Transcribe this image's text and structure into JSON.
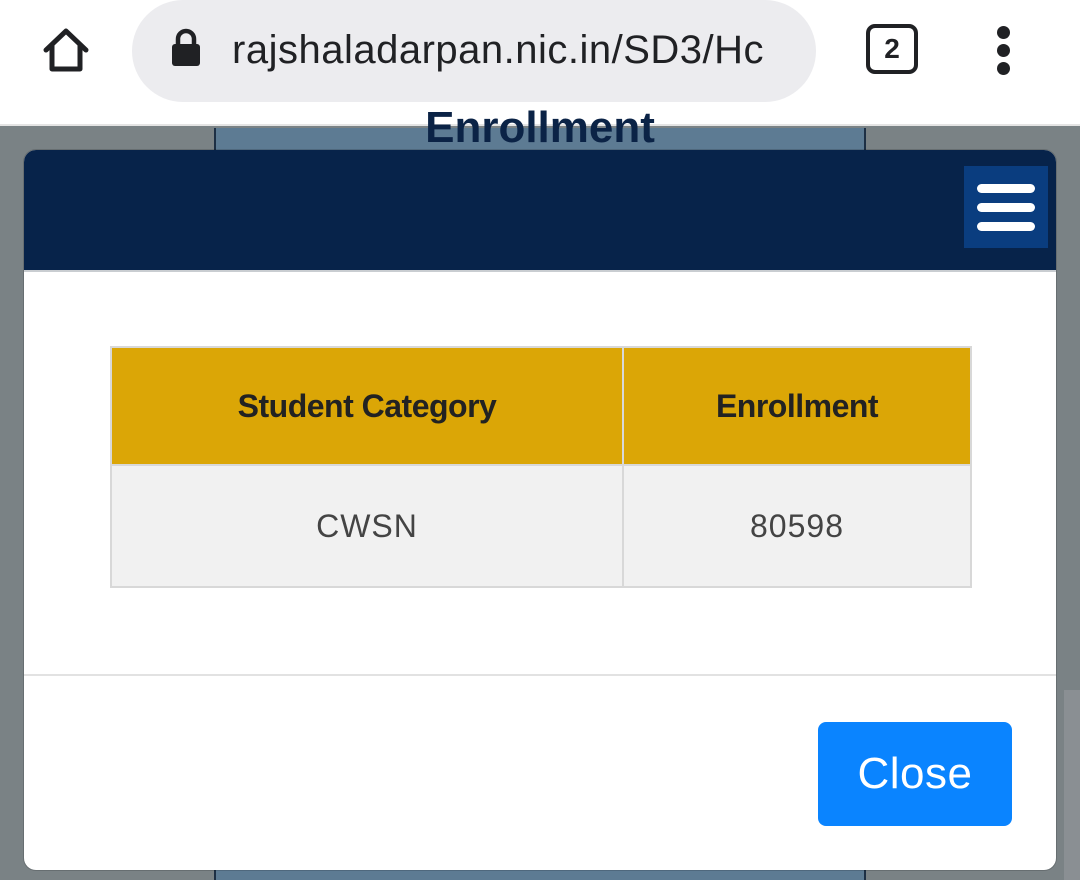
{
  "browser": {
    "url": "rajshaladarpan.nic.in/SD3/Hc",
    "tab_count": "2",
    "icons": {
      "home": "home-icon",
      "lock": "lock-icon",
      "menu": "vertical-dots-icon"
    }
  },
  "background_page": {
    "heading": "Enrollment"
  },
  "modal": {
    "header": {
      "menu_icon": "hamburger-icon",
      "color": "#07234a"
    },
    "table": {
      "headers": [
        "Student Category",
        "Enrollment"
      ],
      "rows": [
        {
          "category": "CWSN",
          "enrollment": "80598"
        }
      ],
      "header_color": "#dba606"
    },
    "footer": {
      "close_label": "Close",
      "close_color": "#0a84ff"
    }
  }
}
